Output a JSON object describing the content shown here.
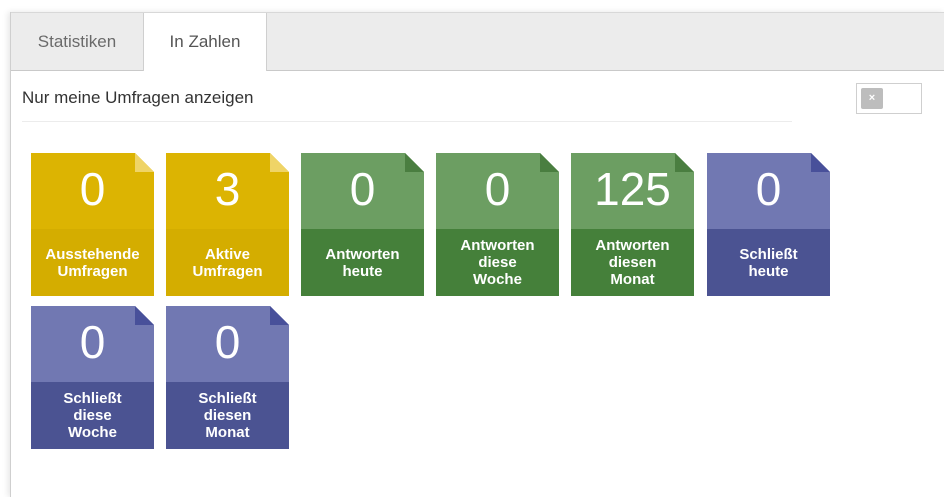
{
  "tabs": [
    {
      "label": "Statistiken",
      "active": false
    },
    {
      "label": "In Zahlen",
      "active": true
    }
  ],
  "filter": {
    "label": "Nur meine Umfragen anzeigen",
    "toggle_on": false,
    "toggle_icon": "×"
  },
  "colors": {
    "pending": "#dcb402",
    "responses": "#45803a",
    "closing": "#4b5392"
  },
  "tiles": [
    {
      "value": "0",
      "label": "Ausstehende\nUmfragen",
      "color": "yellow"
    },
    {
      "value": "3",
      "label": "Aktive\nUmfragen",
      "color": "yellow"
    },
    {
      "value": "0",
      "label": "Antworten\nheute",
      "color": "green"
    },
    {
      "value": "0",
      "label": "Antworten\ndiese\nWoche",
      "color": "green"
    },
    {
      "value": "125",
      "label": "Antworten\ndiesen\nMonat",
      "color": "green"
    },
    {
      "value": "0",
      "label": "Schließt\nheute",
      "color": "blue"
    },
    {
      "value": "0",
      "label": "Schließt\ndiese\nWoche",
      "color": "blue"
    },
    {
      "value": "0",
      "label": "Schließt\ndiesen\nMonat",
      "color": "blue"
    }
  ]
}
